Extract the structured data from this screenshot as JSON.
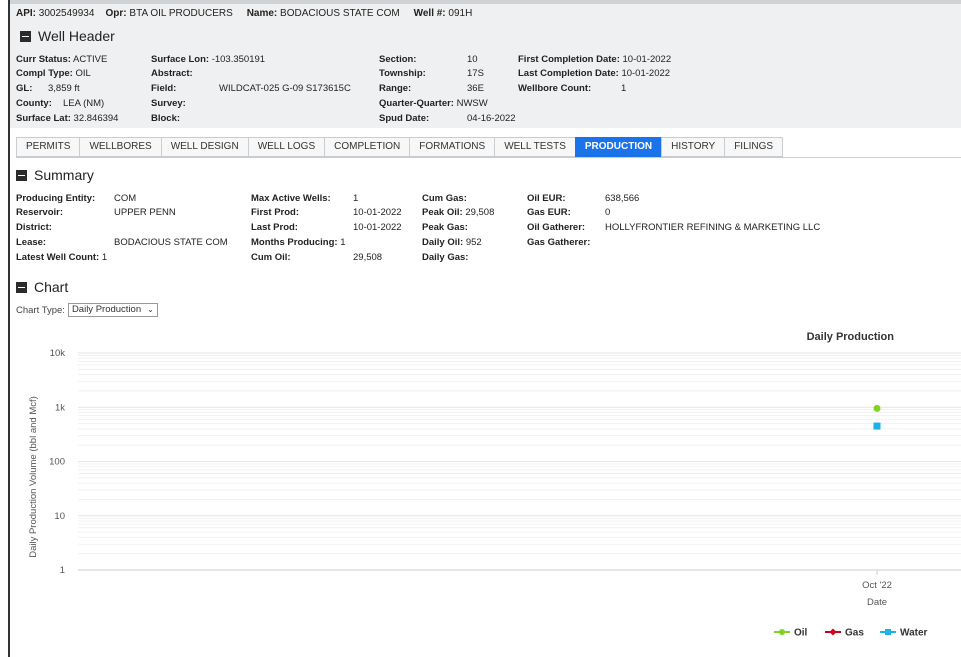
{
  "header": {
    "api_label": "API:",
    "api_value": "3002549934",
    "opr_label": "Opr:",
    "opr_value": "BTA OIL PRODUCERS",
    "name_label": "Name:",
    "name_value": "BODACIOUS STATE COM",
    "well_label": "Well #:",
    "well_value": "091H"
  },
  "well_header": {
    "title": "Well Header",
    "fields": {
      "curr_status": {
        "label": "Curr Status:",
        "value": "ACTIVE"
      },
      "compl_type": {
        "label": "Compl Type:",
        "value": "OIL"
      },
      "gl": {
        "label": "GL:",
        "value": "3,859 ft"
      },
      "county": {
        "label": "County:",
        "value": "LEA (NM)"
      },
      "surface_lat": {
        "label": "Surface Lat:",
        "value": "32.846394"
      },
      "surface_lon": {
        "label": "Surface Lon:",
        "value": "-103.350191"
      },
      "abstract": {
        "label": "Abstract:",
        "value": ""
      },
      "field": {
        "label": "Field:",
        "value": "WILDCAT-025 G-09 S173615C"
      },
      "survey": {
        "label": "Survey:",
        "value": ""
      },
      "block": {
        "label": "Block:",
        "value": ""
      },
      "section": {
        "label": "Section:",
        "value": "10"
      },
      "township": {
        "label": "Township:",
        "value": "17S"
      },
      "range": {
        "label": "Range:",
        "value": "36E"
      },
      "quarter": {
        "label": "Quarter-Quarter:",
        "value": "NWSW"
      },
      "spud": {
        "label": "Spud Date:",
        "value": "04-16-2022"
      },
      "first_completion": {
        "label": "First Completion Date:",
        "value": "10-01-2022"
      },
      "last_completion": {
        "label": "Last Completion Date:",
        "value": "10-01-2022"
      },
      "wellbore_count": {
        "label": "Wellbore Count:",
        "value": "1"
      }
    }
  },
  "tabs": [
    "PERMITS",
    "WELLBORES",
    "WELL DESIGN",
    "WELL LOGS",
    "COMPLETION",
    "FORMATIONS",
    "WELL TESTS",
    "PRODUCTION",
    "HISTORY",
    "FILINGS"
  ],
  "active_tab": "PRODUCTION",
  "summary": {
    "title": "Summary",
    "fields": {
      "producing_entity": {
        "label": "Producing Entity:",
        "value": "COM"
      },
      "reservoir": {
        "label": "Reservoir:",
        "value": "UPPER PENN"
      },
      "district": {
        "label": "District:",
        "value": ""
      },
      "lease": {
        "label": "Lease:",
        "value": "BODACIOUS STATE COM"
      },
      "latest_well_count": {
        "label": "Latest Well Count:",
        "value": "1"
      },
      "max_active_wells": {
        "label": "Max Active Wells:",
        "value": "1"
      },
      "first_prod": {
        "label": "First Prod:",
        "value": "10-01-2022"
      },
      "last_prod": {
        "label": "Last Prod:",
        "value": "10-01-2022"
      },
      "months_producing": {
        "label": "Months Producing:",
        "value": "1"
      },
      "cum_oil": {
        "label": "Cum Oil:",
        "value": "29,508"
      },
      "cum_gas": {
        "label": "Cum Gas:",
        "value": ""
      },
      "peak_oil": {
        "label": "Peak Oil:",
        "value": "29,508"
      },
      "peak_gas": {
        "label": "Peak Gas:",
        "value": ""
      },
      "daily_oil": {
        "label": "Daily Oil:",
        "value": "952"
      },
      "daily_gas": {
        "label": "Daily Gas:",
        "value": ""
      },
      "oil_eur": {
        "label": "Oil EUR:",
        "value": "638,566"
      },
      "gas_eur": {
        "label": "Gas EUR:",
        "value": "0"
      },
      "oil_gatherer": {
        "label": "Oil Gatherer:",
        "value": "HOLLYFRONTIER REFINING & MARKETING LLC"
      },
      "gas_gatherer": {
        "label": "Gas Gatherer:",
        "value": ""
      }
    }
  },
  "chart_section": {
    "title": "Chart",
    "chart_type_label": "Chart Type:",
    "chart_type_value": "Daily Production"
  },
  "colors": {
    "oil": "#7ed321",
    "gas": "#d0021b",
    "water": "#1ab2e8",
    "active_tab": "#1a73e8"
  },
  "chart_data": {
    "type": "scatter",
    "title": "Daily Production",
    "xlabel": "Date",
    "ylabel": "Daily Production Volume (bbl and Mcf)",
    "y_scale": "log",
    "ylim": [
      1,
      10000
    ],
    "y_ticks": [
      "1",
      "10",
      "100",
      "1k",
      "10k"
    ],
    "x_categories": [
      "Oct '22"
    ],
    "series": [
      {
        "name": "Oil",
        "x": "Oct '22",
        "y": 952,
        "marker": "circle"
      },
      {
        "name": "Gas",
        "x": "Oct '22",
        "y": null,
        "marker": "diamond"
      },
      {
        "name": "Water",
        "x": "Oct '22",
        "y": 450,
        "marker": "square"
      }
    ],
    "legend": [
      "Oil",
      "Gas",
      "Water"
    ],
    "legend_position": "bottom-right",
    "grid": true
  }
}
